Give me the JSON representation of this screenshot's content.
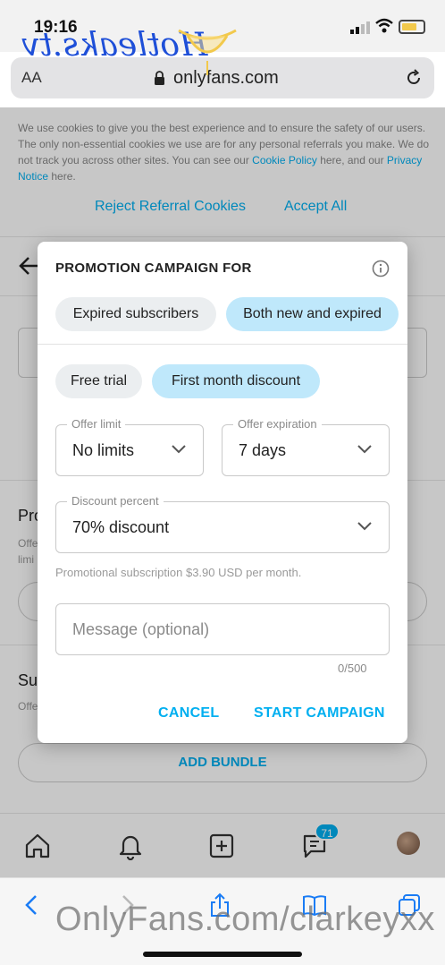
{
  "status_bar": {
    "time": "19:16"
  },
  "url_bar": {
    "text_size_label": "AA",
    "domain": "onlyfans.com"
  },
  "watermark_logo": {
    "text": "Hotleaks.tv"
  },
  "cookie_banner": {
    "text_before": "We use cookies to give you the best experience and to ensure the safety of our users. The only non-essential cookies we use are for any personal referrals you make. We do not track you across other sites. You can see our ",
    "cookie_policy_link": "Cookie Policy",
    "text_middle": " here, and our ",
    "privacy_link": "Privacy Notice",
    "text_after": " here.",
    "reject_label": "Reject Referral Cookies",
    "accept_label": "Accept All"
  },
  "background": {
    "section_title_1": "Pro",
    "section_sub_1": "Offe limi",
    "section_title_2": "Su",
    "section_sub_2": "Offe",
    "add_bundle_label": "ADD BUNDLE"
  },
  "tab_bar": {
    "messages_badge": "71"
  },
  "dialog": {
    "title": "PROMOTION CAMPAIGN FOR",
    "audience_options": [
      {
        "label": "Expired subscribers",
        "selected": false
      },
      {
        "label": "Both new and expired",
        "selected": true
      }
    ],
    "type_options": [
      {
        "label": "Free trial",
        "selected": false
      },
      {
        "label": "First month discount",
        "selected": true
      }
    ],
    "offer_limit": {
      "label": "Offer limit",
      "value": "No limits"
    },
    "offer_expiration": {
      "label": "Offer expiration",
      "value": "7 days"
    },
    "discount_percent": {
      "label": "Discount percent",
      "value": "70% discount"
    },
    "promo_note": "Promotional subscription $3.90 USD per month.",
    "message_placeholder": "Message (optional)",
    "message_counter": "0/500",
    "cancel_label": "CANCEL",
    "start_label": "START CAMPAIGN"
  },
  "watermark_text": "OnlyFans.com/clarkeyxx",
  "colors": {
    "accent": "#00aff0",
    "chip_selected": "#bfe8fb",
    "chip_unselected": "#ebeef0"
  }
}
